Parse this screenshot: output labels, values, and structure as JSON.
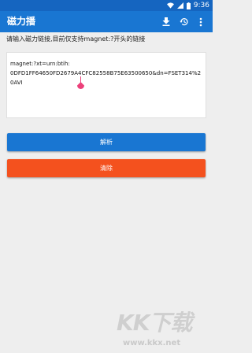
{
  "status": {
    "time": "9:36"
  },
  "appbar": {
    "title": "磁力播"
  },
  "hint": "请输入磁力链接,目前仅支持magnet:?开头的链接",
  "input": {
    "value": "magnet:?xt=urn:btih:\n0DFD1FF64650FD2679A4CFC82558B75E63500650&dn=FSET314%20AVI"
  },
  "buttons": {
    "parse": "解析",
    "clear": "清除"
  },
  "watermark": {
    "logo": "KK下载",
    "url": "www.kkx.net"
  },
  "colors": {
    "primary": "#1976d2",
    "primary_dark": "#1565c0",
    "clear": "#f4511e",
    "caret": "#ec407a"
  }
}
